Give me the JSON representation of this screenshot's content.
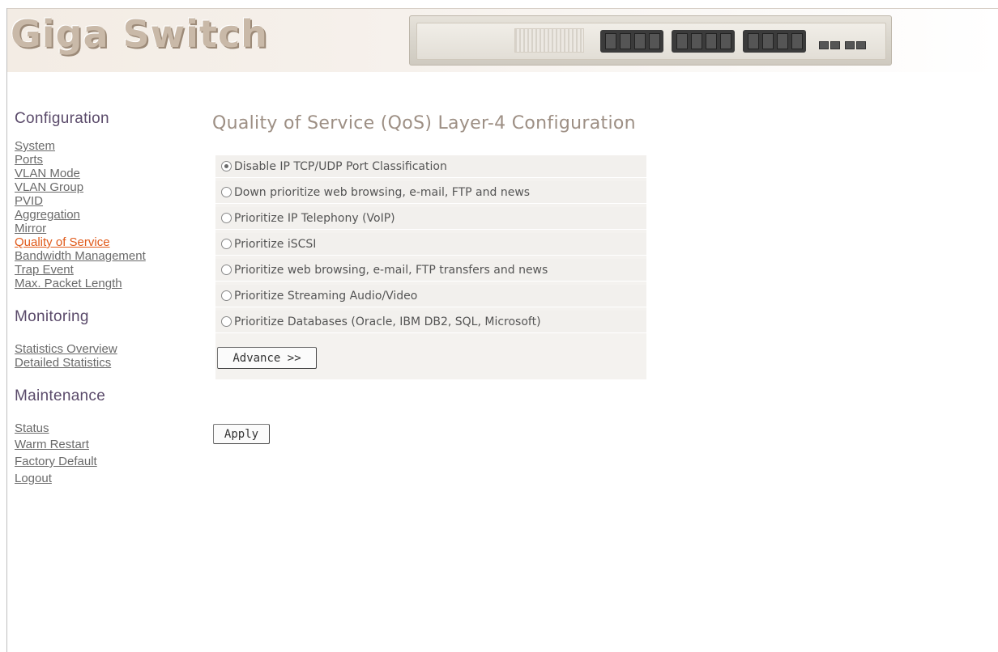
{
  "header": {
    "logo_text": "Giga Switch",
    "device_image": "switch-front-panel"
  },
  "sidebar": {
    "sections": [
      {
        "heading": "Configuration",
        "items": [
          "System",
          "Ports",
          "VLAN Mode",
          "VLAN Group",
          "PVID",
          "Aggregation",
          "Mirror",
          "Quality of Service",
          "Bandwidth Management",
          "Trap Event",
          "Max. Packet Length"
        ]
      },
      {
        "heading": "Monitoring",
        "items": [
          "Statistics Overview",
          "Detailed Statistics"
        ]
      },
      {
        "heading": "Maintenance",
        "items": [
          "Status",
          "Warm Restart",
          "Factory Default",
          "Logout"
        ]
      }
    ],
    "active_item": "Quality of Service",
    "active_color": "#e05a1a"
  },
  "main": {
    "title": "Quality of Service (QoS) Layer-4 Configuration",
    "options": [
      {
        "label": "Disable IP TCP/UDP Port Classification",
        "checked": true
      },
      {
        "label": "Down prioritize web browsing, e-mail, FTP and news",
        "checked": false
      },
      {
        "label": "Prioritize IP Telephony (VoIP)",
        "checked": false
      },
      {
        "label": "Prioritize iSCSI",
        "checked": false
      },
      {
        "label": "Prioritize web browsing, e-mail, FTP transfers and news",
        "checked": false
      },
      {
        "label": "Prioritize Streaming Audio/Video",
        "checked": false
      },
      {
        "label": "Prioritize Databases (Oracle, IBM DB2, SQL, Microsoft)",
        "checked": false
      }
    ],
    "advance_label": "Advance >>",
    "apply_label": "Apply"
  }
}
